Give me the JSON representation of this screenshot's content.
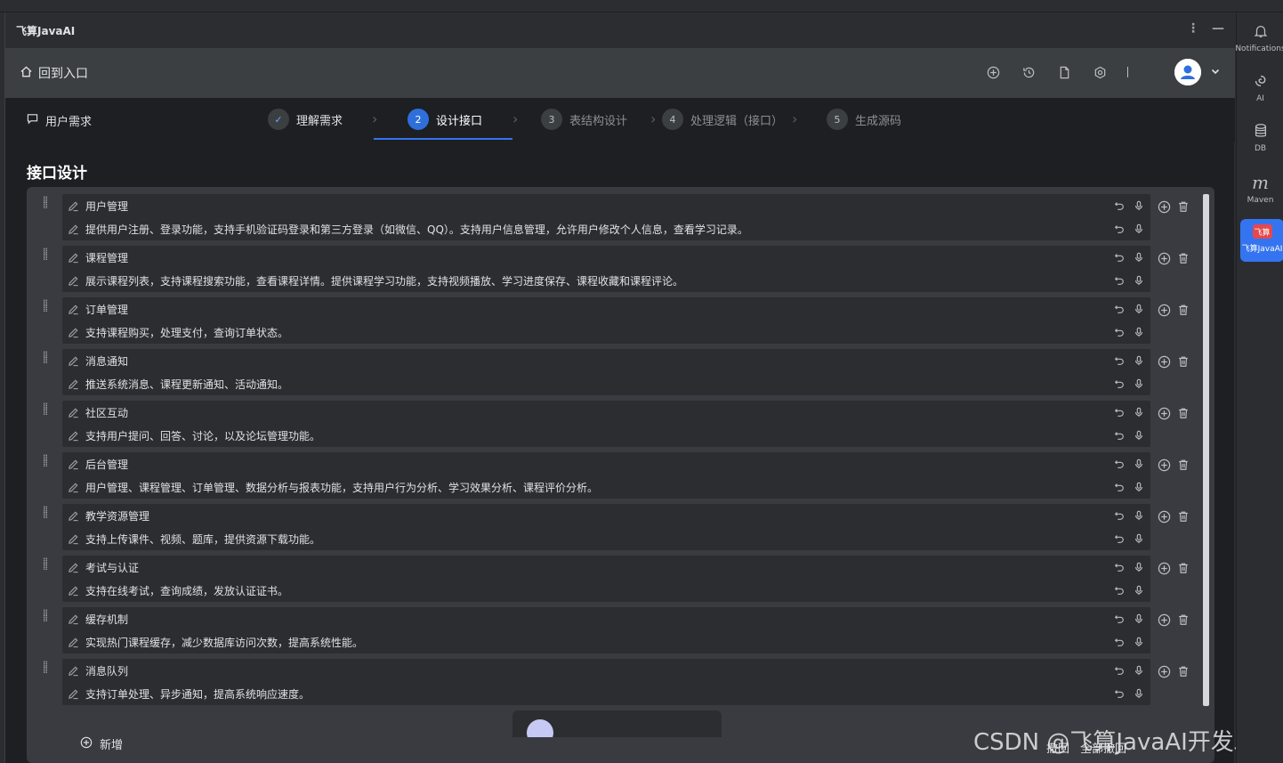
{
  "app": {
    "title": "飞算JavaAI",
    "home_label": "回到入口"
  },
  "steps": {
    "requirement_label": "用户需求",
    "items": [
      {
        "num": "✓",
        "label": "理解需求",
        "state": "done"
      },
      {
        "num": "2",
        "label": "设计接口",
        "state": "active"
      },
      {
        "num": "3",
        "label": "表结构设计",
        "state": "pending"
      },
      {
        "num": "4",
        "label": "处理逻辑（接口）",
        "state": "pending"
      },
      {
        "num": "5",
        "label": "生成源码",
        "state": "pending"
      }
    ]
  },
  "section_title": "接口设计",
  "interfaces": [
    {
      "name": "用户管理",
      "desc": "提供用户注册、登录功能，支持手机验证码登录和第三方登录（如微信、QQ）。支持用户信息管理，允许用户修改个人信息，查看学习记录。"
    },
    {
      "name": "课程管理",
      "desc": "展示课程列表，支持课程搜索功能，查看课程详情。提供课程学习功能，支持视频播放、学习进度保存、课程收藏和课程评论。"
    },
    {
      "name": "订单管理",
      "desc": "支持课程购买，处理支付，查询订单状态。"
    },
    {
      "name": "消息通知",
      "desc": "推送系统消息、课程更新通知、活动通知。"
    },
    {
      "name": "社区互动",
      "desc": "支持用户提问、回答、讨论，以及论坛管理功能。"
    },
    {
      "name": "后台管理",
      "desc": "用户管理、课程管理、订单管理、数据分析与报表功能，支持用户行为分析、学习效果分析、课程评价分析。"
    },
    {
      "name": "教学资源管理",
      "desc": "支持上传课件、视频、题库，提供资源下载功能。"
    },
    {
      "name": "考试与认证",
      "desc": "支持在线考试，查询成绩，发放认证证书。"
    },
    {
      "name": "缓存机制",
      "desc": "实现热门课程缓存，减少数据库访问次数，提高系统性能。"
    },
    {
      "name": "消息队列",
      "desc": "支持订单处理、异步通知，提高系统响应速度。"
    }
  ],
  "actions": {
    "add_new": "新增",
    "undo": "撤回",
    "undo_all": "全部撤回"
  },
  "watermark": "CSDN @飞算JavaAI开发助手",
  "right_sidebar": [
    {
      "label": "Notifications",
      "icon": "bell-icon"
    },
    {
      "label": "AI",
      "icon": "ai-swirl-icon"
    },
    {
      "label": "DB",
      "icon": "database-icon"
    },
    {
      "label": "Maven",
      "icon": "maven-icon"
    },
    {
      "label": "飞算JavaAI",
      "icon": "feisuan-logo-icon",
      "badge": "飞算"
    }
  ],
  "colors": {
    "accent": "#3574f0",
    "background": "#1e1f22",
    "panel": "#393b40"
  }
}
